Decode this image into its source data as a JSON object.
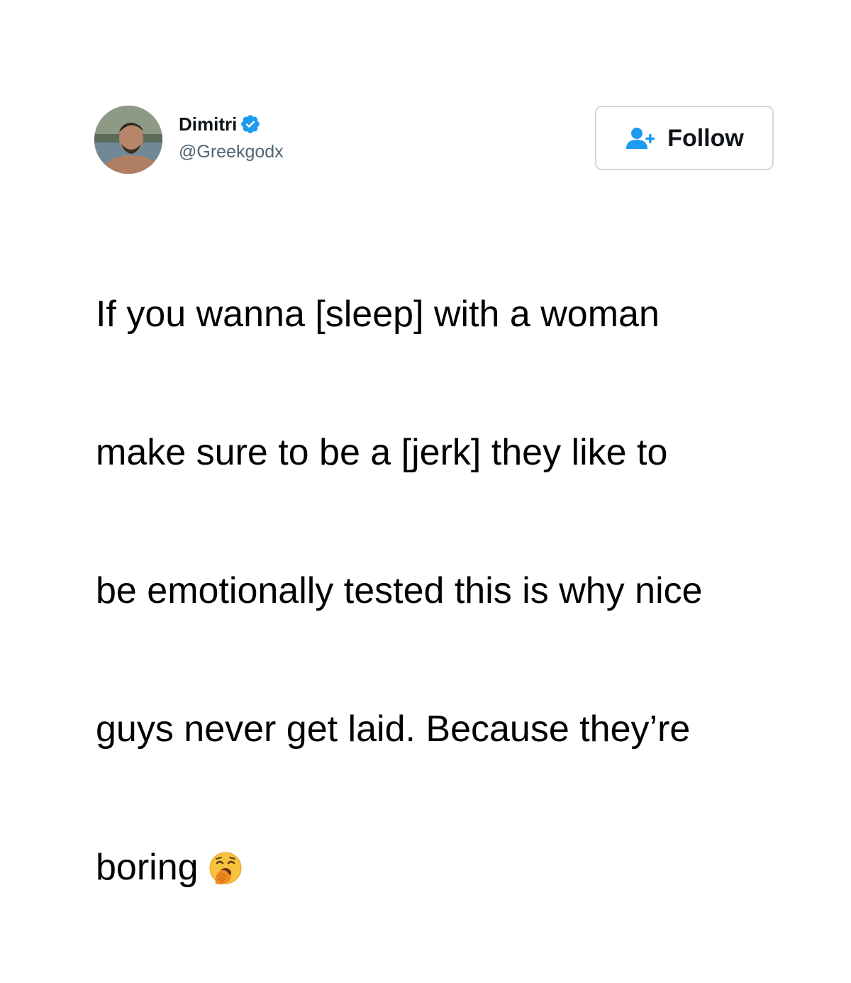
{
  "author": {
    "name": "Dimitri",
    "handle": "@Greekgodx",
    "verified": true,
    "verified_color": "#1d9bf0"
  },
  "follow_button": {
    "label": "Follow",
    "icon": "add-user-icon",
    "icon_color": "#1d9bf0"
  },
  "tweet": {
    "lines": [
      "If you wanna [sleep] with a woman",
      "make sure to be a [jerk] they like to",
      "be emotionally tested this is why nice",
      "guys never get laid. Because they’re",
      "boring"
    ],
    "emoji": "yawning-face-emoji"
  }
}
